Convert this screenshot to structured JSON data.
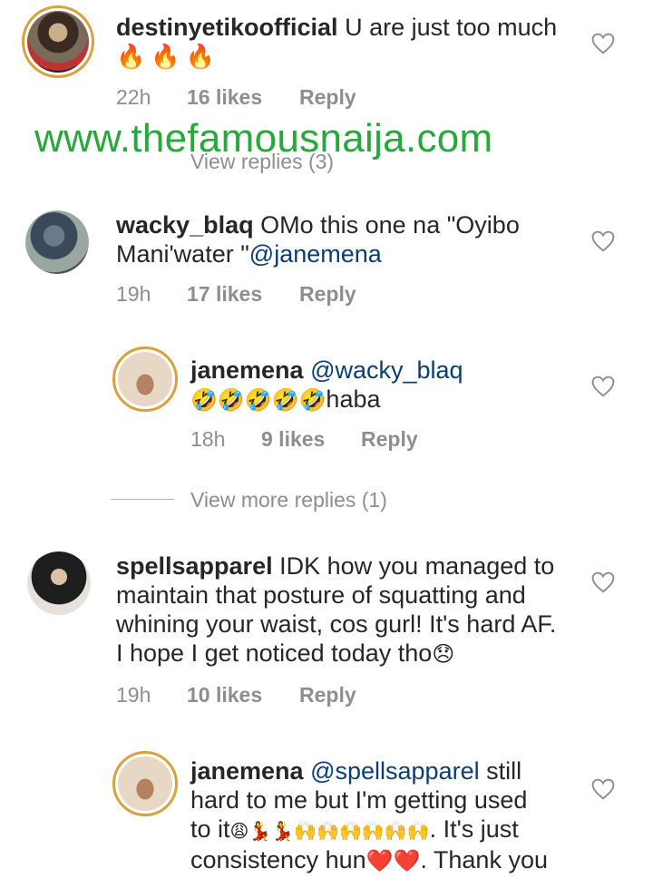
{
  "watermark": "www.thefamousnaija.com",
  "comments": [
    {
      "username": "destinyetikoofficial",
      "text": "U are just too much",
      "emojis": "🔥🔥🔥",
      "time": "22h",
      "likes": "16 likes",
      "reply": "Reply",
      "view_replies": "View replies (3)"
    },
    {
      "username": "wacky_blaq",
      "text_line1": "OMo this one na \"Oyibo",
      "text_line2": "Mani'water \"",
      "mention": "@janemena",
      "time": "19h",
      "likes": "17 likes",
      "reply": "Reply"
    },
    {
      "username": "janemena",
      "mention": "@wacky_blaq",
      "emojis": "🤣🤣🤣🤣🤣",
      "text": "haba",
      "time": "18h",
      "likes": "9 likes",
      "reply": "Reply",
      "view_more": "View more replies (1)"
    },
    {
      "username": "spellsapparel",
      "text_line1": "IDK how you managed to",
      "text_line2": "maintain that posture of squatting and",
      "text_line3": "whining your waist, cos gurl! It's hard AF.",
      "text_line4": "I hope I get noticed today tho",
      "emoji_end": "😞",
      "time": "19h",
      "likes": "10 likes",
      "reply": "Reply"
    },
    {
      "username": "janemena",
      "mention": "@spellsapparel",
      "text_line1": "still",
      "text_line2": "hard to me but I'm getting used",
      "text_line3_a": "to it",
      "emojis_a": "😩💃💃🙌🙌🙌🙌🙌🙌",
      "text_line3_b": ". It's just",
      "text_line4_a": "consistency hun",
      "emojis_b": "❤️❤️",
      "text_line4_b": ". Thank you"
    }
  ],
  "icons": {
    "heart": "heart-outline-icon"
  }
}
